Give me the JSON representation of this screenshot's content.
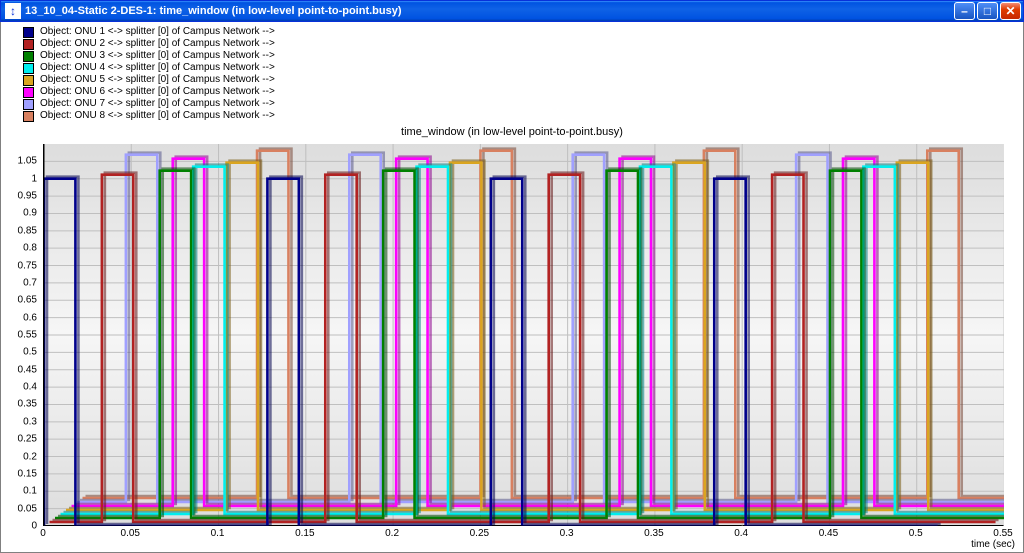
{
  "window": {
    "title": "13_10_04-Static 2-DES-1: time_window (in low-level point-to-point.busy)"
  },
  "legend": {
    "items": [
      {
        "label": "Object: ONU 1 <-> splitter [0] of Campus Network -->",
        "color": "#00008B"
      },
      {
        "label": "Object: ONU 2 <-> splitter [0] of Campus Network -->",
        "color": "#B22222"
      },
      {
        "label": "Object: ONU 3 <-> splitter [0] of Campus Network -->",
        "color": "#008000"
      },
      {
        "label": "Object: ONU 4 <-> splitter [0] of Campus Network -->",
        "color": "#00EEEE"
      },
      {
        "label": "Object: ONU 5 <-> splitter [0] of Campus Network -->",
        "color": "#DAA520"
      },
      {
        "label": "Object: ONU 6 <-> splitter [0] of Campus Network -->",
        "color": "#FF00FF"
      },
      {
        "label": "Object: ONU 7 <-> splitter [0] of Campus Network -->",
        "color": "#A0A0FF"
      },
      {
        "label": "Object: ONU 8 <-> splitter [0] of Campus Network -->",
        "color": "#D88060"
      }
    ]
  },
  "chart_data": {
    "type": "line",
    "title": "time_window (in low-level point-to-point.busy)",
    "xlabel": "time (sec)",
    "ylabel": "",
    "xlim": [
      0,
      0.55
    ],
    "ylim": [
      0,
      1.1
    ],
    "x_ticks": [
      0,
      0.05,
      0.1,
      0.15,
      0.2,
      0.25,
      0.3,
      0.35,
      0.4,
      0.45,
      0.5,
      0.55
    ],
    "y_ticks": [
      0,
      0.05,
      0.1,
      0.15,
      0.2,
      0.25,
      0.3,
      0.35,
      0.4,
      0.45,
      0.5,
      0.55,
      0.6,
      0.65,
      0.7,
      0.75,
      0.8,
      0.85,
      0.9,
      0.95,
      1,
      1.05
    ],
    "pulse_width": 0.018,
    "period": 0.128,
    "n_periods": 4,
    "amplitude": 1,
    "depth_offset": {
      "dx": 5.5,
      "dy": -4
    },
    "series": [
      {
        "name": "ONU 1",
        "color": "#00008B",
        "start": 0.0
      },
      {
        "name": "ONU 2",
        "color": "#B22222",
        "start": 0.03
      },
      {
        "name": "ONU 3",
        "color": "#008000",
        "start": 0.06
      },
      {
        "name": "ONU 4",
        "color": "#00EEEE",
        "start": 0.076
      },
      {
        "name": "ONU 5",
        "color": "#DAA520",
        "start": 0.092
      },
      {
        "name": "ONU 6",
        "color": "#FF00FF",
        "start": 0.058
      },
      {
        "name": "ONU 7",
        "color": "#A0A0FF",
        "start": 0.028
      },
      {
        "name": "ONU 8",
        "color": "#D88060",
        "start": 0.1
      }
    ],
    "note": "Each series is a periodic rectangular pulse train between 0 and 1; pulses are offset in time per ONU and rendered with a 3D depth offset per series index."
  }
}
